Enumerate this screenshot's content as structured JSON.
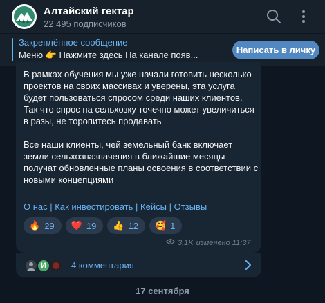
{
  "header": {
    "title": "Алтайский гектар",
    "subscribers": "22 495 подписчиков",
    "icons": [
      "search-icon",
      "more-vertical-icon"
    ]
  },
  "pinned": {
    "title": "Закреплённое сообщение",
    "text": "Меню 👉  Нажмите здесь  На канале появ...",
    "button": "Написать в личку"
  },
  "message": {
    "paragraph1": "В рамках обучения мы уже начали готовить несколько проектов на своих массивах и уверены, эта услуга будет пользоваться спросом среди наших клиентов. Так что спрос на сельхозку точечно может увеличиться в разы, не торопитесь продавать",
    "paragraph2": "Все наши клиенты, чей земельный банк включает земли сельхозназначения в ближайшие месяцы получат обновленные планы освоения в соответствии с новыми концепциями",
    "links": [
      "О нас",
      "Как инвестировать",
      "Кейсы",
      "Отзывы"
    ],
    "reactions": [
      {
        "emoji": "🔥",
        "count": "29"
      },
      {
        "emoji": "❤️",
        "count": "19"
      },
      {
        "emoji": "👍",
        "count": "12"
      },
      {
        "emoji": "🥰",
        "count": "1"
      }
    ],
    "views": "3,1K",
    "edited": "изменено 11:37"
  },
  "comments": {
    "label": "4 комментария",
    "avatar_letter": "И"
  },
  "date_separator": "17 сентября",
  "colors": {
    "background": "#0e1621",
    "panel": "#17212b",
    "bubble": "#182533",
    "accent": "#6ab3f3",
    "button": "#5288c1"
  }
}
